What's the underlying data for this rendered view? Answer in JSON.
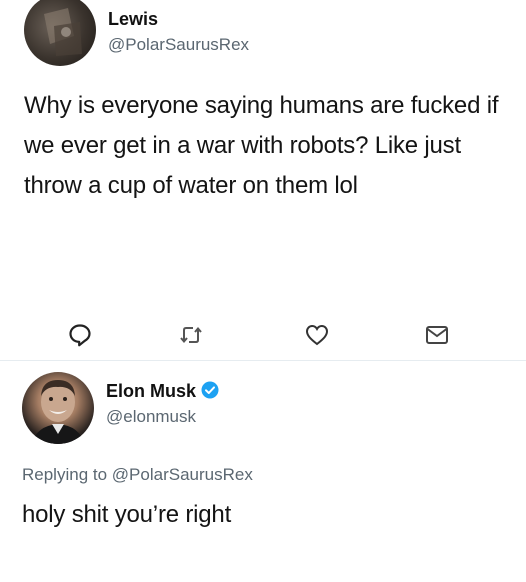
{
  "tweet1": {
    "name": "Lewis",
    "handle": "@PolarSaurusRex",
    "text": "Why is everyone saying humans are fucked if we ever get in a war with robots? Like just throw a cup of water on them lol"
  },
  "tweet2": {
    "name": "Elon Musk",
    "handle": "@elonmusk",
    "verified": true,
    "replying_prefix": "Replying to",
    "replying_to": "@PolarSaurusRex",
    "text": "holy shit you’re right"
  },
  "icons": {
    "reply": "speech-bubble-icon",
    "retweet": "retweet-icon",
    "like": "heart-icon",
    "share": "envelope-icon",
    "verified": "verified-badge-icon"
  },
  "colors": {
    "text": "#141414",
    "secondary": "#5b6771",
    "verified": "#1da1f2"
  }
}
